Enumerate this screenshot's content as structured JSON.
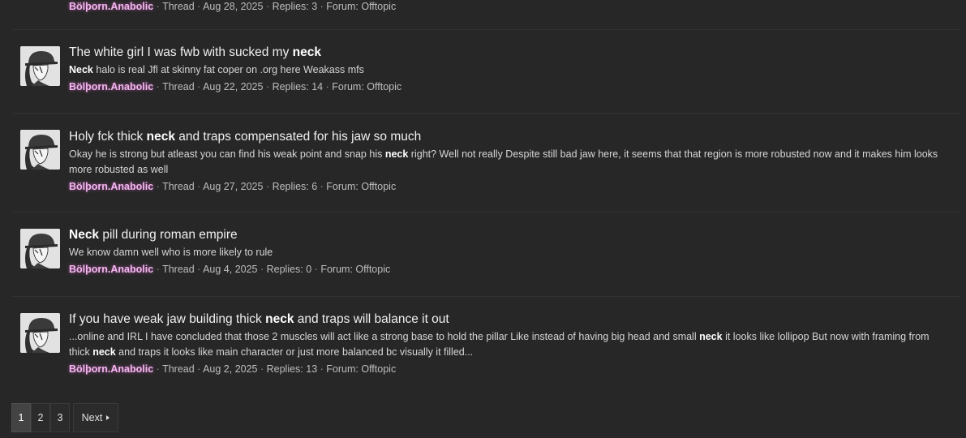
{
  "results": [
    {
      "title": [],
      "snippet": [],
      "meta": {
        "author": "Bölþorn.Anabolic",
        "type": "Thread",
        "date": "Aug 28, 2025",
        "replies": "Replies: 3",
        "forum": "Forum: Offtopic"
      }
    },
    {
      "title": [
        {
          "text": "The white girl I was fwb with sucked my ",
          "bold": false
        },
        {
          "text": "neck",
          "bold": true
        }
      ],
      "snippet": [
        {
          "text": "Neck",
          "bold": true
        },
        {
          "text": " halo is real Jfl at skinny fat coper on .org here Weakass mfs",
          "bold": false
        }
      ],
      "meta": {
        "author": "Bölþorn.Anabolic",
        "type": "Thread",
        "date": "Aug 22, 2025",
        "replies": "Replies: 14",
        "forum": "Forum: Offtopic"
      }
    },
    {
      "title": [
        {
          "text": "Holy fck thick ",
          "bold": false
        },
        {
          "text": "neck",
          "bold": true
        },
        {
          "text": " and traps compensated for his jaw so much",
          "bold": false
        }
      ],
      "snippet": [
        {
          "text": "Okay he is strong but atleast you can find his weak point and snap his ",
          "bold": false
        },
        {
          "text": "neck",
          "bold": true
        },
        {
          "text": " right? Well not really Despite still bad jaw here, it seems that that region is more robusted now and it makes him looks more robusted as well",
          "bold": false
        }
      ],
      "meta": {
        "author": "Bölþorn.Anabolic",
        "type": "Thread",
        "date": "Aug 27, 2025",
        "replies": "Replies: 6",
        "forum": "Forum: Offtopic"
      }
    },
    {
      "title": [
        {
          "text": "Neck",
          "bold": true
        },
        {
          "text": " pill during roman empire",
          "bold": false
        }
      ],
      "snippet": [
        {
          "text": "We know damn well who is more likely to rule",
          "bold": false
        }
      ],
      "meta": {
        "author": "Bölþorn.Anabolic",
        "type": "Thread",
        "date": "Aug 4, 2025",
        "replies": "Replies: 0",
        "forum": "Forum: Offtopic"
      }
    },
    {
      "title": [
        {
          "text": "If you have weak jaw building thick ",
          "bold": false
        },
        {
          "text": "neck",
          "bold": true
        },
        {
          "text": " and traps will balance it out",
          "bold": false
        }
      ],
      "snippet": [
        {
          "text": "...online and IRL I have concluded that those 2 muscles will act like a strong base to hold the pillar Like instead of having big head and small ",
          "bold": false
        },
        {
          "text": "neck",
          "bold": true
        },
        {
          "text": " it looks like lollipop But now with framing from thick ",
          "bold": false
        },
        {
          "text": "neck",
          "bold": true
        },
        {
          "text": " and traps it looks like main character or just more balanced bc visually it filled...",
          "bold": false
        }
      ],
      "meta": {
        "author": "Bölþorn.Anabolic",
        "type": "Thread",
        "date": "Aug 2, 2025",
        "replies": "Replies: 13",
        "forum": "Forum: Offtopic"
      }
    }
  ],
  "separator": " · ",
  "pagination": {
    "pages": [
      "1",
      "2",
      "3"
    ],
    "current": "1",
    "next_label": "Next"
  }
}
